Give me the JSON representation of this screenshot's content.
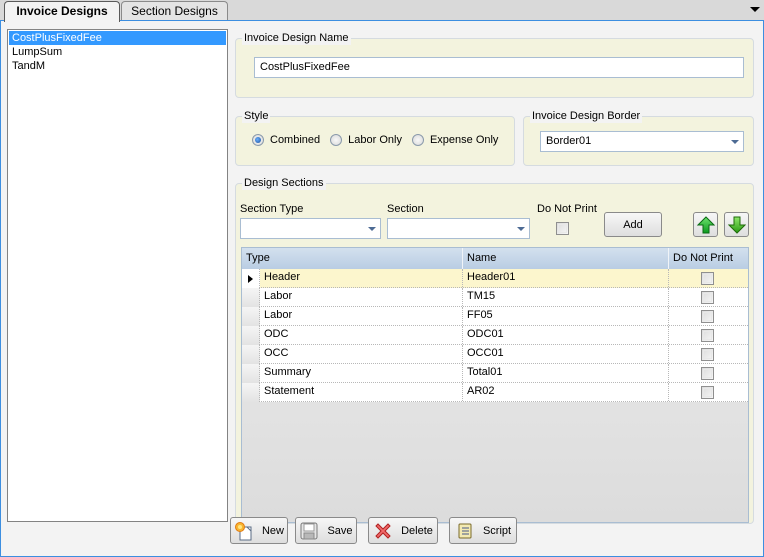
{
  "tabs": [
    {
      "label": "Invoice Designs",
      "active": true
    },
    {
      "label": "Section Designs",
      "active": false
    }
  ],
  "design_list": {
    "items": [
      "CostPlusFixedFee",
      "LumpSum",
      "TandM"
    ],
    "selected": "CostPlusFixedFee"
  },
  "invoice_design_name": {
    "title": "Invoice Design Name",
    "value": "CostPlusFixedFee"
  },
  "style": {
    "title": "Style",
    "options": [
      "Combined",
      "Labor Only",
      "Expense Only"
    ],
    "selected": "Combined"
  },
  "border": {
    "title": "Invoice Design Border",
    "value": "Border01"
  },
  "design_sections": {
    "title": "Design Sections",
    "section_type_label": "Section Type",
    "section_type_value": "",
    "section_label": "Section",
    "section_value": "",
    "do_not_print_label": "Do Not Print",
    "do_not_print_checked": false,
    "add_label": "Add",
    "move_up_icon": "green-up-arrow-icon",
    "move_down_icon": "green-down-arrow-icon",
    "columns": [
      "Type",
      "Name",
      "Do Not Print"
    ],
    "rows": [
      {
        "type": "Header",
        "name": "Header01",
        "do_not_print": false,
        "current": true
      },
      {
        "type": "Labor",
        "name": "TM15",
        "do_not_print": false
      },
      {
        "type": "Labor",
        "name": "FF05",
        "do_not_print": false
      },
      {
        "type": "ODC",
        "name": "ODC01",
        "do_not_print": false
      },
      {
        "type": "OCC",
        "name": "OCC01",
        "do_not_print": false
      },
      {
        "type": "Summary",
        "name": "Total01",
        "do_not_print": false
      },
      {
        "type": "Statement",
        "name": "AR02",
        "do_not_print": false
      }
    ]
  },
  "toolbar": {
    "new_label": "New",
    "save_label": "Save",
    "delete_label": "Delete",
    "script_label": "Script"
  },
  "colors": {
    "accent": "#3399ff",
    "panel_border": "#3c8ee0",
    "group_bg": "#f3f3de",
    "current_row": "#fcf6cd"
  }
}
